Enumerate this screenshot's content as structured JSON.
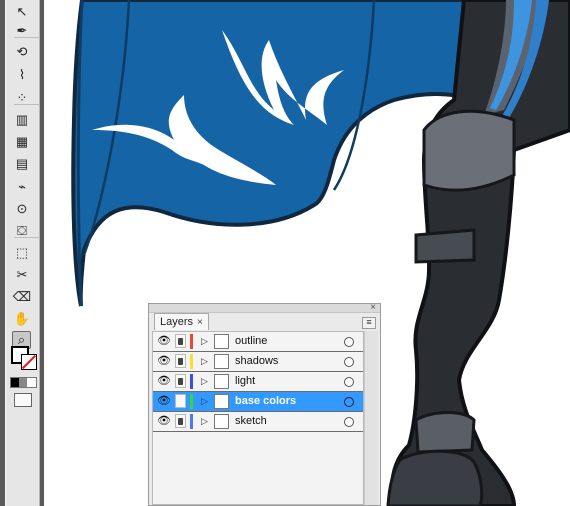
{
  "tools": [
    {
      "icon": "selection-tool-icon",
      "glyph": "↖"
    },
    {
      "icon": "pen-tool-icon",
      "glyph": "✒"
    },
    {
      "icon": "rotate-tool-icon",
      "glyph": "⟲"
    },
    {
      "icon": "warp-tool-icon",
      "glyph": "⌇"
    },
    {
      "icon": "symbol-sprayer-icon",
      "glyph": "⁘"
    },
    {
      "icon": "graph-tool-icon",
      "glyph": "▥"
    },
    {
      "icon": "mesh-tool-icon",
      "glyph": "▦"
    },
    {
      "icon": "gradient-tool-icon",
      "glyph": "▤"
    },
    {
      "icon": "eyedropper-icon",
      "glyph": "⌁"
    },
    {
      "icon": "blend-tool-icon",
      "glyph": "⊙"
    },
    {
      "icon": "live-paint-bucket-icon",
      "glyph": "⛋"
    },
    {
      "icon": "live-paint-selection-icon",
      "glyph": "⬚"
    },
    {
      "icon": "slice-tool-icon",
      "glyph": "✂"
    },
    {
      "icon": "eraser-tool-icon",
      "glyph": "⌫"
    },
    {
      "icon": "hand-tool-icon",
      "glyph": "✋"
    },
    {
      "icon": "zoom-tool-icon",
      "glyph": "⌕"
    }
  ],
  "layers_panel": {
    "tab_label": "Layers",
    "tab_close": "×",
    "close_glyph": "×",
    "menu_glyph": "≡",
    "layers": [
      {
        "name": "outline",
        "color": "#e8483a",
        "selected": false
      },
      {
        "name": "shadows",
        "color": "#f2e22a",
        "selected": false
      },
      {
        "name": "light",
        "color": "#3f4fd8",
        "selected": false
      },
      {
        "name": "base colors",
        "color": "#39d33c",
        "selected": true
      },
      {
        "name": "sketch",
        "color": "#4f79e8",
        "selected": false
      }
    ]
  },
  "colors": {
    "cape_blue": "#1565a6",
    "ui_gray": "#e6e6e6",
    "selection_blue": "#3399ff"
  }
}
